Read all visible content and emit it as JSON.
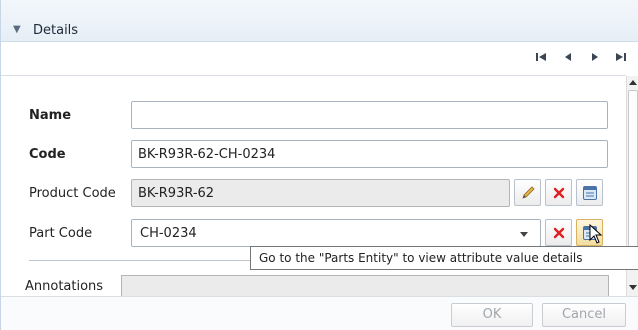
{
  "section": {
    "title": "Details"
  },
  "pager": {
    "first": "first",
    "prev": "previous",
    "next": "next",
    "last": "last"
  },
  "form": {
    "name": {
      "label": "Name",
      "value": ""
    },
    "code": {
      "label": "Code",
      "value": "BK-R93R-62-CH-0234"
    },
    "product_code": {
      "label": "Product Code",
      "value": "BK-R93R-62"
    },
    "part_code": {
      "label": "Part Code",
      "value": "CH-0234"
    },
    "annotations": {
      "label": "Annotations"
    }
  },
  "tooltip": {
    "text": "Go to the \"Parts Entity\" to view attribute value details"
  },
  "footer": {
    "ok_label": "OK",
    "cancel_label": "Cancel"
  },
  "icons": {
    "collapse": "chevron-down-icon",
    "edit": "pencil-icon",
    "clear": "red-x-icon",
    "navigate": "entity-view-icon"
  },
  "colors": {
    "header_bg": "#e9f0f7",
    "readonly_bg": "#ebebeb",
    "clear_red": "#e02020"
  }
}
